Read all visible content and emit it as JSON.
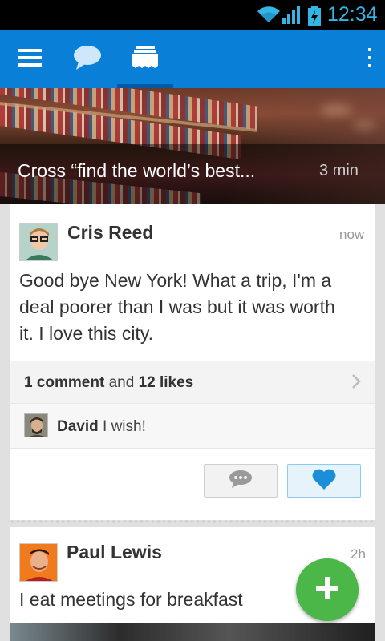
{
  "status_bar": {
    "time": "12:34"
  },
  "action_bar": {
    "tabs": [
      {
        "icon": "menu-icon"
      },
      {
        "icon": "chat-bubble-icon"
      },
      {
        "icon": "feed-cards-icon",
        "selected": true
      }
    ],
    "overflow_icon": "overflow-menu-icon"
  },
  "hero": {
    "caption": "Cross “find the world’s best...",
    "time": "3 min"
  },
  "posts": [
    {
      "author": "Cris Reed",
      "time": "now",
      "text_lines": [
        "Good bye New York! What a trip, I'm a",
        "deal poorer than I was but it was worth",
        "it. I love this city."
      ],
      "stats": {
        "comments": "1 comment",
        "and": "and",
        "likes": "12 likes"
      },
      "comment": {
        "name": "David",
        "text": "I wish!"
      },
      "liked": true
    },
    {
      "author": "Paul Lewis",
      "time": "2h",
      "text": "I eat meetings for breakfast"
    }
  ],
  "colors": {
    "action_bar": "#0a7fd8",
    "accent_blue": "#33b5e5",
    "fab_green": "#4cb749",
    "like_heart": "#1a8fd8"
  },
  "fab": {
    "icon": "plus-icon"
  }
}
